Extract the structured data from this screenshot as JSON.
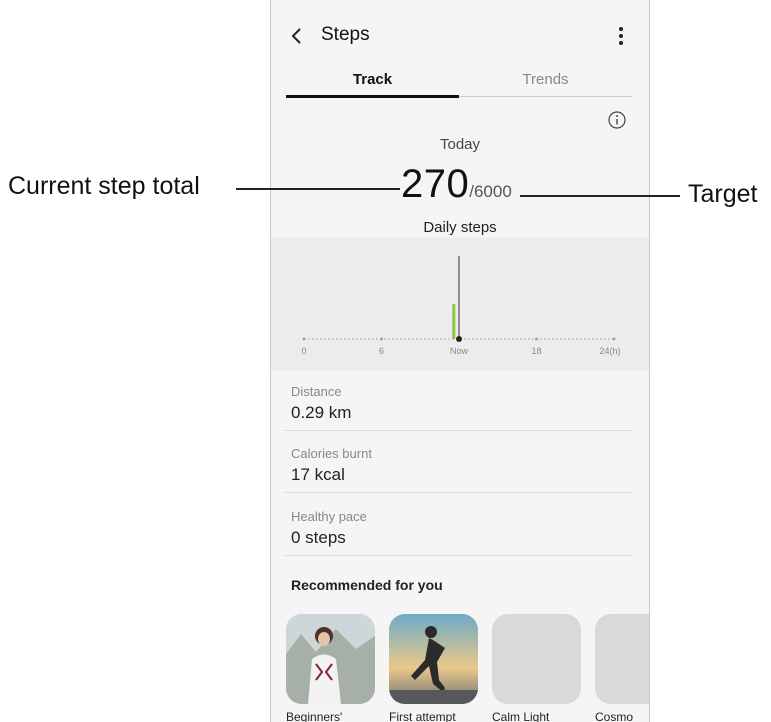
{
  "header": {
    "title": "Steps"
  },
  "tabs": [
    {
      "label": "Track",
      "active": true
    },
    {
      "label": "Trends",
      "active": false
    }
  ],
  "summary": {
    "period": "Today",
    "current_steps": "270",
    "target_steps": "/6000",
    "caption": "Daily steps"
  },
  "chart_data": {
    "type": "bar",
    "x_tick_labels": [
      "0",
      "6",
      "Now",
      "18",
      "24(h)"
    ],
    "bar_hour": 11.6,
    "bar_fraction": 0.42,
    "now_hour": 12
  },
  "stats": [
    {
      "label": "Distance",
      "value": "0.29 km"
    },
    {
      "label": "Calories burnt",
      "value": "17 kcal"
    },
    {
      "label": "Healthy pace",
      "value": "0 steps"
    }
  ],
  "recommended": {
    "heading": "Recommended for you",
    "cards": [
      {
        "label": "Beginners'"
      },
      {
        "label": "First attempt"
      },
      {
        "label": "Calm Light"
      },
      {
        "label": "Cosmo"
      }
    ]
  },
  "callouts": {
    "left": "Current step total",
    "right": "Target"
  },
  "colors": {
    "bar": "#8cc63f",
    "chart_bg": "#ececec"
  }
}
